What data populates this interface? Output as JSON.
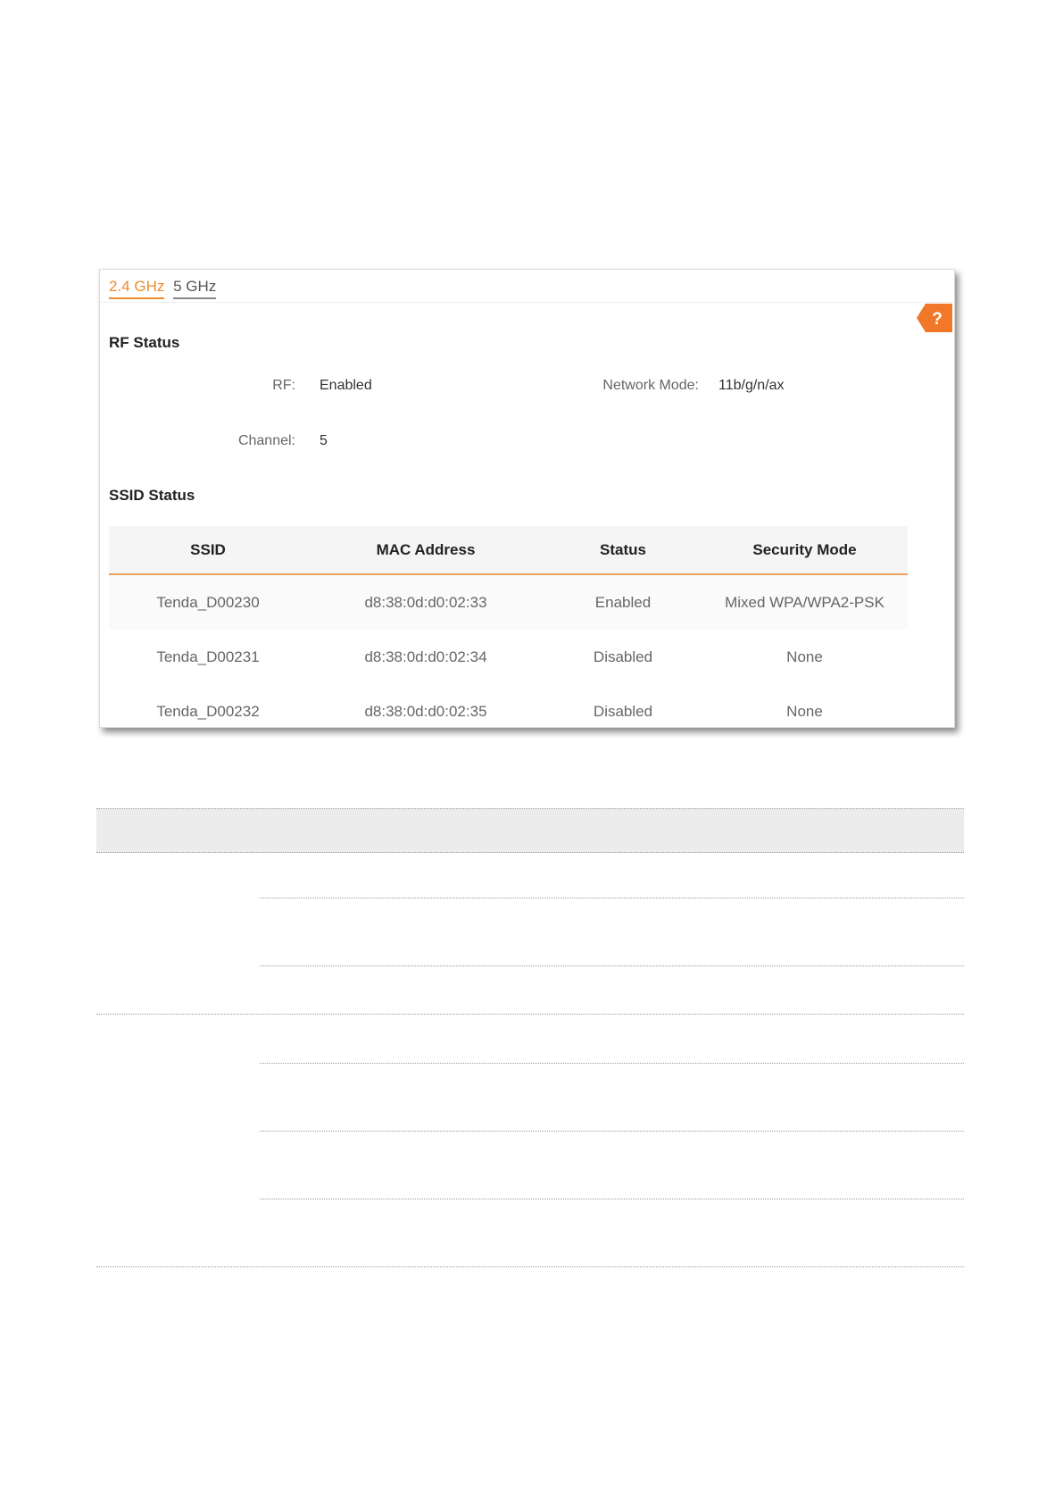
{
  "tabs": [
    {
      "label": "2.4 GHz",
      "active": true
    },
    {
      "label": "5 GHz",
      "active": false
    }
  ],
  "help": {
    "label": "?"
  },
  "rf_status": {
    "title": "RF Status",
    "rf_label": "RF:",
    "rf_value": "Enabled",
    "network_mode_label": "Network Mode:",
    "network_mode_value": "11b/g/n/ax",
    "channel_label": "Channel:",
    "channel_value": "5"
  },
  "ssid_status": {
    "title": "SSID Status",
    "columns": [
      "SSID",
      "MAC Address",
      "Status",
      "Security Mode"
    ],
    "rows": [
      [
        "Tenda_D00230",
        "d8:38:0d:d0:02:33",
        "Enabled",
        "Mixed WPA/WPA2-PSK"
      ],
      [
        "Tenda_D00231",
        "d8:38:0d:d0:02:34",
        "Disabled",
        "None"
      ],
      [
        "Tenda_D00232",
        "d8:38:0d:d0:02:35",
        "Disabled",
        "None"
      ]
    ]
  },
  "colors": {
    "accent": "#f08a2c",
    "help_badge": "#f07828",
    "table_header_bg": "#f5f5f5",
    "table_header_rule": "#e9a15c"
  }
}
